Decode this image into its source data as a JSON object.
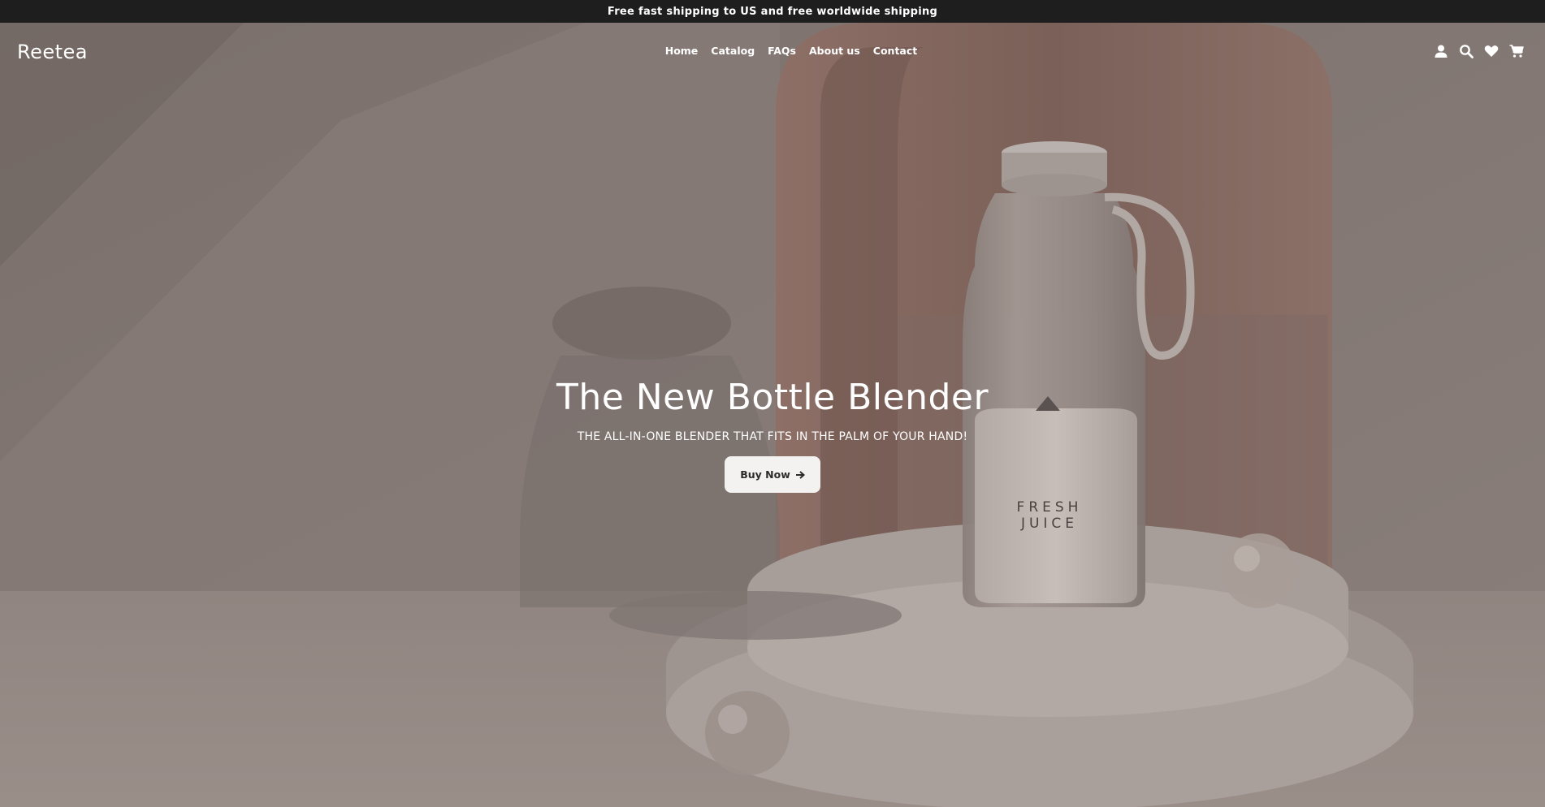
{
  "announcement": {
    "text": "Free fast shipping to US and free worldwide shipping"
  },
  "header": {
    "logo": "Reetea",
    "nav": [
      {
        "label": "Home"
      },
      {
        "label": "Catalog"
      },
      {
        "label": "FAQs"
      },
      {
        "label": "About us"
      },
      {
        "label": "Contact"
      }
    ],
    "icons": [
      "account-icon",
      "search-icon",
      "heart-icon",
      "cart-icon"
    ]
  },
  "hero": {
    "title": "The New Bottle Blender",
    "subtitle": "THE ALL-IN-ONE BLENDER THAT FITS IN THE PALM OF YOUR HAND!",
    "button_label": "Buy Now",
    "button_icon": "arrow-right-icon",
    "product_label_line1": "FRESH",
    "product_label_line2": "JUICE"
  },
  "colors": {
    "announcement_bg": "#1e1e1e",
    "hero_overlay": "#857a76",
    "button_bg": "#f4f2f1",
    "text_light": "#ffffff"
  }
}
